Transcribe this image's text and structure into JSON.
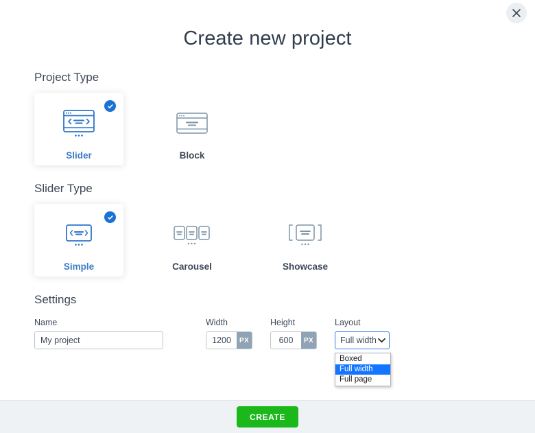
{
  "modal": {
    "title": "Create new project",
    "close_label": "×",
    "close_icon": "close-icon"
  },
  "project_type": {
    "heading": "Project Type",
    "options": [
      {
        "label": "Slider",
        "icon": "slider-window-icon",
        "selected": true
      },
      {
        "label": "Block",
        "icon": "block-window-icon",
        "selected": false
      }
    ]
  },
  "slider_type": {
    "heading": "Slider Type",
    "options": [
      {
        "label": "Simple",
        "icon": "simple-slide-icon",
        "selected": true
      },
      {
        "label": "Carousel",
        "icon": "carousel-slides-icon",
        "selected": false
      },
      {
        "label": "Showcase",
        "icon": "showcase-slide-icon",
        "selected": false
      }
    ]
  },
  "settings": {
    "heading": "Settings",
    "name": {
      "label": "Name",
      "value": "My project",
      "placeholder": "My project"
    },
    "width": {
      "label": "Width",
      "value": "1200",
      "unit": "PX"
    },
    "height": {
      "label": "Height",
      "value": "600",
      "unit": "PX"
    },
    "layout": {
      "label": "Layout",
      "selected": "Full width",
      "expanded": true,
      "options": [
        "Boxed",
        "Full width",
        "Full page"
      ]
    }
  },
  "footer": {
    "create_label": "CREATE"
  },
  "colors": {
    "accent_blue": "#1a73d4",
    "select_border_blue": "#2f7ae0",
    "highlight_blue": "#1476ff",
    "create_green": "#1bb81b",
    "icon_grey": "#7d93a6",
    "text_slate": "#3c4858",
    "footer_bg": "#eef2f4",
    "unit_badge": "#8fa3b4"
  }
}
